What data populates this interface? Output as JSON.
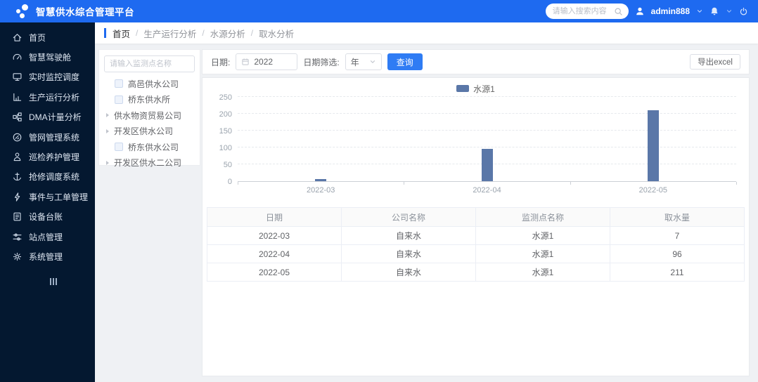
{
  "app": {
    "title": "智慧供水综合管理平台"
  },
  "header": {
    "search_placeholder": "请输入搜索内容",
    "username": "admin888"
  },
  "breadcrumb": {
    "items": [
      "首页",
      "生产运行分析",
      "水源分析",
      "取水分析"
    ]
  },
  "sidebar": {
    "items": [
      {
        "label": "首页",
        "icon": "home-icon"
      },
      {
        "label": "智慧驾驶舱",
        "icon": "cockpit-icon"
      },
      {
        "label": "实时监控调度",
        "icon": "monitor-icon"
      },
      {
        "label": "生产运行分析",
        "icon": "analysis-icon"
      },
      {
        "label": "DMA计量分析",
        "icon": "dma-icon"
      },
      {
        "label": "管网管理系统",
        "icon": "pipeline-icon"
      },
      {
        "label": "巡检养护管理",
        "icon": "inspection-icon"
      },
      {
        "label": "抢修调度系统",
        "icon": "repair-icon"
      },
      {
        "label": "事件与工单管理",
        "icon": "workorder-icon"
      },
      {
        "label": "设备台账",
        "icon": "device-icon"
      },
      {
        "label": "站点管理",
        "icon": "station-icon"
      },
      {
        "label": "系统管理",
        "icon": "gear-icon"
      }
    ]
  },
  "tree": {
    "search_placeholder": "请输入监测点名称",
    "items": [
      {
        "label": "高邑供水公司",
        "type": "checkbox"
      },
      {
        "label": "桥东供水所",
        "type": "checkbox"
      },
      {
        "label": "供水物资贸易公司",
        "type": "expand"
      },
      {
        "label": "开发区供水公司",
        "type": "expand"
      },
      {
        "label": "桥东供水公司",
        "type": "checkbox"
      },
      {
        "label": "开发区供水二公司",
        "type": "expand"
      }
    ]
  },
  "toolbar": {
    "date_label": "日期:",
    "date_value": "2022",
    "filter_label": "日期筛选:",
    "filter_value": "年",
    "query_label": "查询",
    "export_label": "导出excel"
  },
  "chart_data": {
    "type": "bar",
    "title": "",
    "categories": [
      "2022-03",
      "2022-04",
      "2022-05"
    ],
    "series": [
      {
        "name": "水源1",
        "values": [
          7,
          96,
          211
        ]
      }
    ],
    "legend": [
      "水源1"
    ],
    "legend_position": "top",
    "xlabel": "",
    "ylabel": "",
    "ylim": [
      0,
      250
    ],
    "yticks": [
      0,
      50,
      100,
      150,
      200,
      250
    ],
    "grid": true,
    "bar_color": "#5a77a8"
  },
  "table": {
    "columns": [
      "日期",
      "公司名称",
      "监测点名称",
      "取水量"
    ],
    "rows": [
      [
        "2022-03",
        "自来水",
        "水源1",
        "7"
      ],
      [
        "2022-04",
        "自来水",
        "水源1",
        "96"
      ],
      [
        "2022-05",
        "自来水",
        "水源1",
        "211"
      ]
    ]
  },
  "colors": {
    "header_blue": "#1e6af0",
    "sidebar_bg": "#041830",
    "accent_blue": "#2f7cf4",
    "bar": "#5a77a8"
  }
}
